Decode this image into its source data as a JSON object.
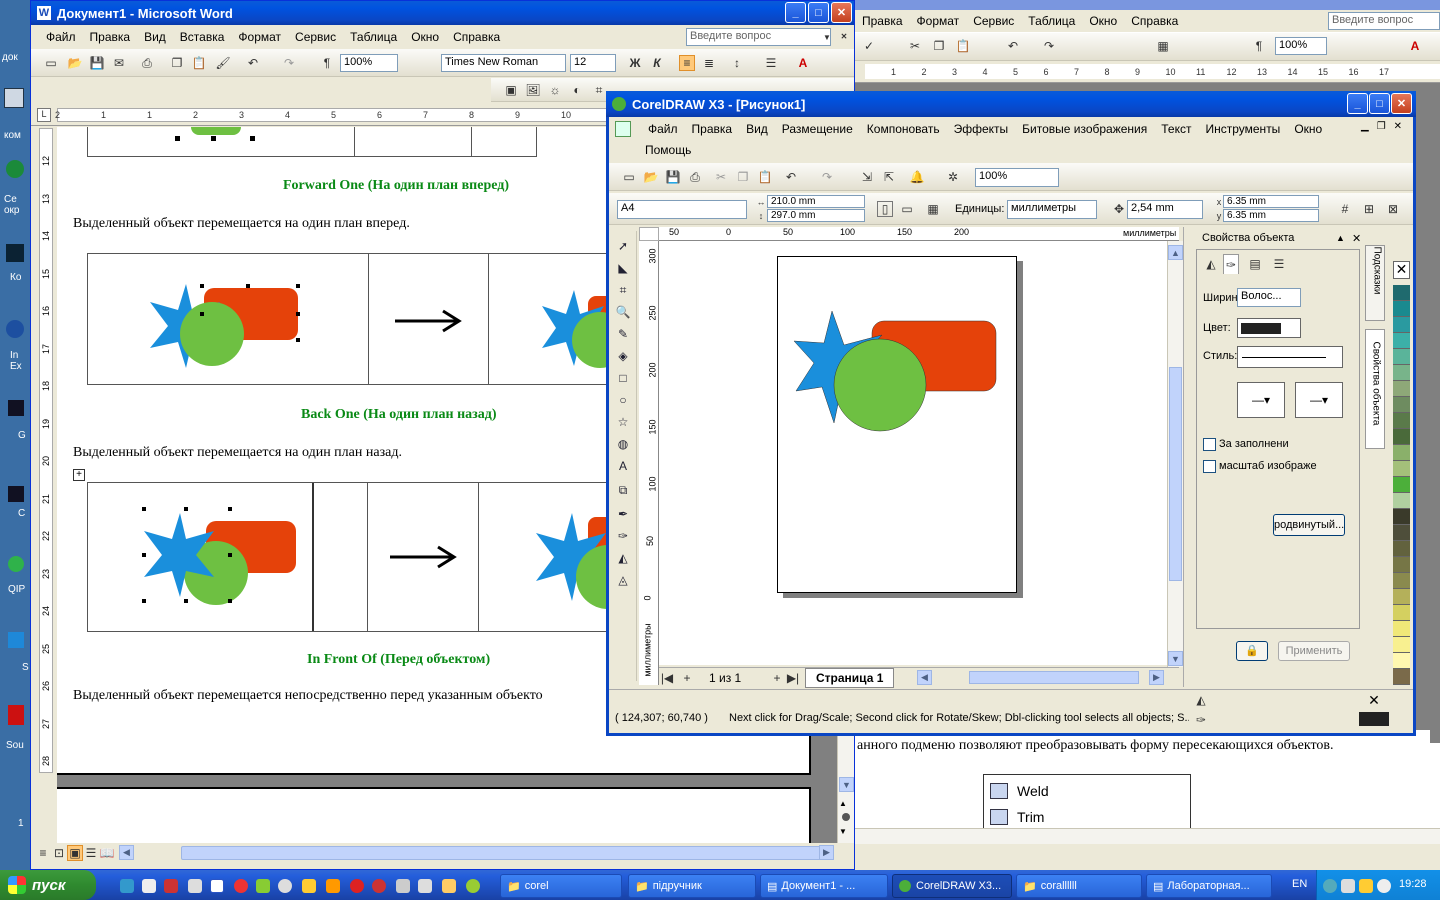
{
  "desktop": {
    "left_icons": [
      "док",
      "ком",
      "Се окр",
      "Ко",
      "In Ex",
      "G",
      "C",
      "QIP",
      "S",
      "Sou",
      "1"
    ]
  },
  "word": {
    "title": "Документ1 - Microsoft Word",
    "menu": [
      "Файл",
      "Правка",
      "Вид",
      "Вставка",
      "Формат",
      "Сервис",
      "Таблица",
      "Окно",
      "Справка"
    ],
    "question_placeholder": "Введите вопрос",
    "zoom": "100%",
    "font_name": "Times New Roman",
    "font_size": "12",
    "headings": [
      "Forward One (На один план вперед)",
      "Back One (На один план назад)",
      "In Front Of (Перед объектом)"
    ],
    "paragraphs": [
      "Выделенный объект перемещается на один план вперед.",
      "Выделенный объект перемещается на один план назад.",
      "Выделенный объект перемещается непосредственно перед указанным объекто"
    ],
    "ruler_numbers": [
      "2",
      "1",
      "1",
      "2",
      "3",
      "4",
      "5",
      "6",
      "7",
      "8",
      "9",
      "10",
      "11",
      "12",
      "13"
    ],
    "vruler_numbers": [
      "12",
      "13",
      "14",
      "15",
      "16",
      "17",
      "18",
      "19",
      "20",
      "21",
      "22",
      "23",
      "24",
      "25",
      "26",
      "27",
      "28"
    ]
  },
  "word2": {
    "title": "Microsoft Word",
    "menu": [
      "Правка",
      "Вид",
      "Вставка",
      "Формат",
      "Сервис",
      "Таблица",
      "Окно",
      "Справка"
    ],
    "question_placeholder": "Введите вопрос",
    "zoom": "100%",
    "ruler_numbers": [
      "1",
      "2",
      "3",
      "4",
      "5",
      "6",
      "7",
      "8",
      "9",
      "10",
      "11",
      "12",
      "13",
      "14",
      "15",
      "16",
      "17"
    ],
    "body_text": "анного подменю позволяют преобразовывать форму пересекающихся объектов.",
    "list_items": [
      "Weld",
      "Trim"
    ]
  },
  "corel": {
    "title": "CorelDRAW X3 - [Рисунок1]",
    "menu_row1": [
      "Файл",
      "Правка",
      "Вид",
      "Размещение",
      "Компоновать",
      "Эффекты",
      "Битовые изображения",
      "Текст",
      "Инструменты",
      "Окно"
    ],
    "menu_row2": [
      "Помощь"
    ],
    "zoom": "100%",
    "paper_size": "A4",
    "width": "210.0 mm",
    "height": "297.0 mm",
    "units_label": "Единицы:",
    "units_value": "миллиметры",
    "nudge": "2,54 mm",
    "dup_x": "6.35 mm",
    "dup_y": "6.35 mm",
    "ruler_units": "миллиметры",
    "hruler_numbers": [
      "50",
      "0",
      "50",
      "100",
      "150",
      "200"
    ],
    "vruler_numbers": [
      "300",
      "250",
      "200",
      "150",
      "100",
      "50",
      "0"
    ],
    "page_counter": "1 из 1",
    "page_tab": "Страница 1",
    "status_coords": "( 124,307; 60,740 )",
    "status_message": "Next click for Drag/Scale; Second click for Rotate/Skew; Dbl-clicking tool selects all objects; S...",
    "docker": {
      "title": "Свойства объекта",
      "width_label": "Ширин",
      "width_value": "Волос...",
      "color_label": "Цвет:",
      "style_label": "Стиль:",
      "behind_fill": "За заполнени",
      "scale_image": "масштаб изображе",
      "advanced": "родвинутый...",
      "apply": "Применить",
      "side_tabs": [
        "Подсказки",
        "Свойства объекта"
      ]
    }
  },
  "taskbar": {
    "start": "пуск",
    "items": [
      "corel",
      "підручник",
      "Документ1 - ...",
      "CorelDRAW X3...",
      "corallllll",
      "Лабораторная..."
    ],
    "lang": "EN",
    "clock": "19:28"
  },
  "colors": {
    "star_blue": "#1a8fdc",
    "rect_orange": "#e5420a",
    "circle_green": "#6ec042",
    "heading_green": "#0a8a16"
  }
}
